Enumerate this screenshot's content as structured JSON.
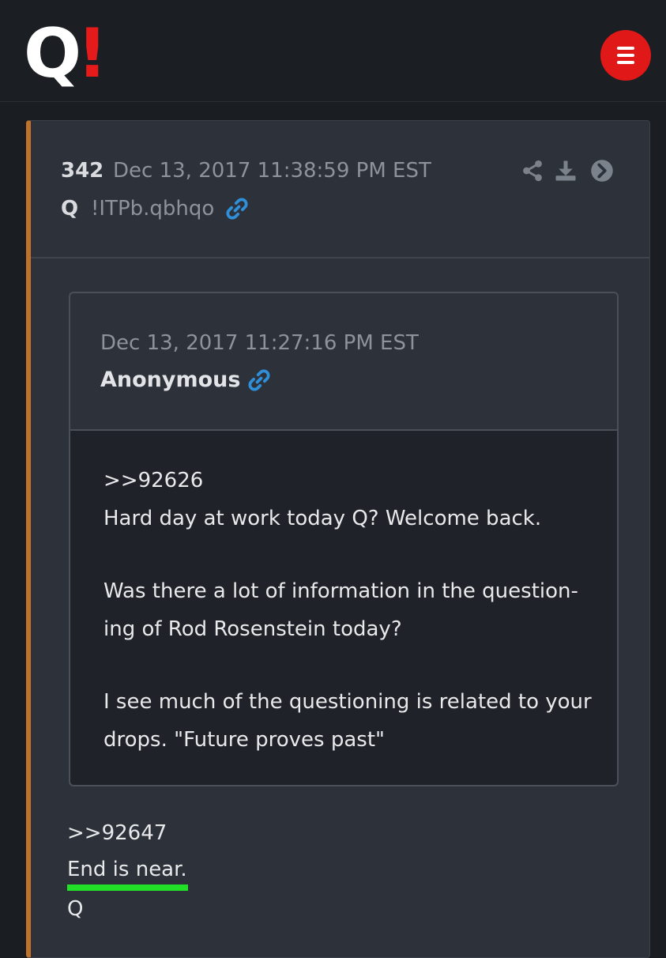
{
  "app": {
    "logo_q": "Q",
    "logo_bang": "!",
    "brand_color": "#e51b1b",
    "menu_icon": "hamburger-icon"
  },
  "post": {
    "number": "342",
    "date": "Dec 13, 2017 11:38:59 PM EST",
    "author": "Q",
    "tripcode": "!ITPb.qbhqo",
    "link_icon": "link-icon",
    "actions": [
      "share-icon",
      "download-icon",
      "arrow-right-circle-icon"
    ],
    "accent_color": "#c0712c"
  },
  "quote": {
    "date": "Dec 13, 2017 11:27:16 PM EST",
    "author": "Anonymous",
    "lines": [
      ">>92626",
      "Hard day at work today Q? Welcome back.",
      "Was there a lot of information in the question-",
      "ing of Rod Rosenstein today?",
      "I see much of the questioning is related to your",
      "drops.  \"Future proves past\""
    ]
  },
  "reply": {
    "lines": [
      ">>92647",
      "End is near.",
      "Q"
    ],
    "highlight_color": "#22e028"
  }
}
